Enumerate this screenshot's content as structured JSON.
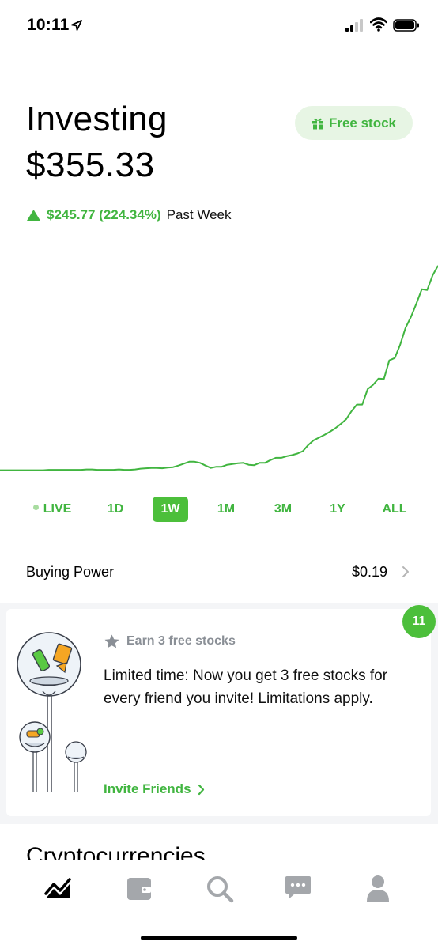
{
  "status_bar": {
    "time": "10:11"
  },
  "header": {
    "title": "Investing",
    "balance": "$355.33",
    "free_stock_label": "Free stock"
  },
  "change": {
    "amount_percent": "$245.77 (224.34%)",
    "period": "Past Week"
  },
  "colors": {
    "accent": "#41b540",
    "active_range_bg": "#4cbf3b",
    "badge": "#4cbf3b",
    "band": "#f4f5f7"
  },
  "chart_data": {
    "type": "line",
    "x_labels": [],
    "values": [
      91,
      91,
      91,
      91,
      91,
      91,
      91,
      91,
      91,
      92,
      92,
      92,
      92,
      92,
      92,
      92,
      93,
      93,
      92,
      92,
      92,
      92,
      93,
      92,
      92,
      93,
      95,
      96,
      97,
      97,
      96,
      98,
      99,
      103,
      108,
      113,
      113,
      110,
      103,
      97,
      100,
      100,
      105,
      107,
      109,
      110,
      105,
      104,
      110,
      110,
      117,
      123,
      123,
      127,
      130,
      134,
      140,
      156,
      168,
      175,
      182,
      190,
      199,
      210,
      222,
      243,
      260,
      260,
      300,
      311,
      327,
      326,
      374,
      380,
      414,
      458,
      486,
      520,
      557,
      555,
      593,
      618
    ],
    "ylim": [
      80,
      630
    ],
    "series_color": "#41b540"
  },
  "ranges": [
    {
      "label": "LIVE",
      "active": false
    },
    {
      "label": "1D",
      "active": false
    },
    {
      "label": "1W",
      "active": true
    },
    {
      "label": "1M",
      "active": false
    },
    {
      "label": "3M",
      "active": false
    },
    {
      "label": "1Y",
      "active": false
    },
    {
      "label": "ALL",
      "active": false
    }
  ],
  "buying_power": {
    "label": "Buying Power",
    "value": "$0.19"
  },
  "promo": {
    "badge_count": "11",
    "header": "Earn 3 free stocks",
    "body": "Limited time: Now you get 3 free stocks for every friend you invite! Limitations apply.",
    "cta": "Invite Friends"
  },
  "section": {
    "crypto_title": "Cryptocurrencies"
  },
  "tabs": [
    {
      "icon": "chart-icon"
    },
    {
      "icon": "wallet-icon"
    },
    {
      "icon": "search-icon"
    },
    {
      "icon": "messages-icon"
    },
    {
      "icon": "profile-icon"
    }
  ]
}
